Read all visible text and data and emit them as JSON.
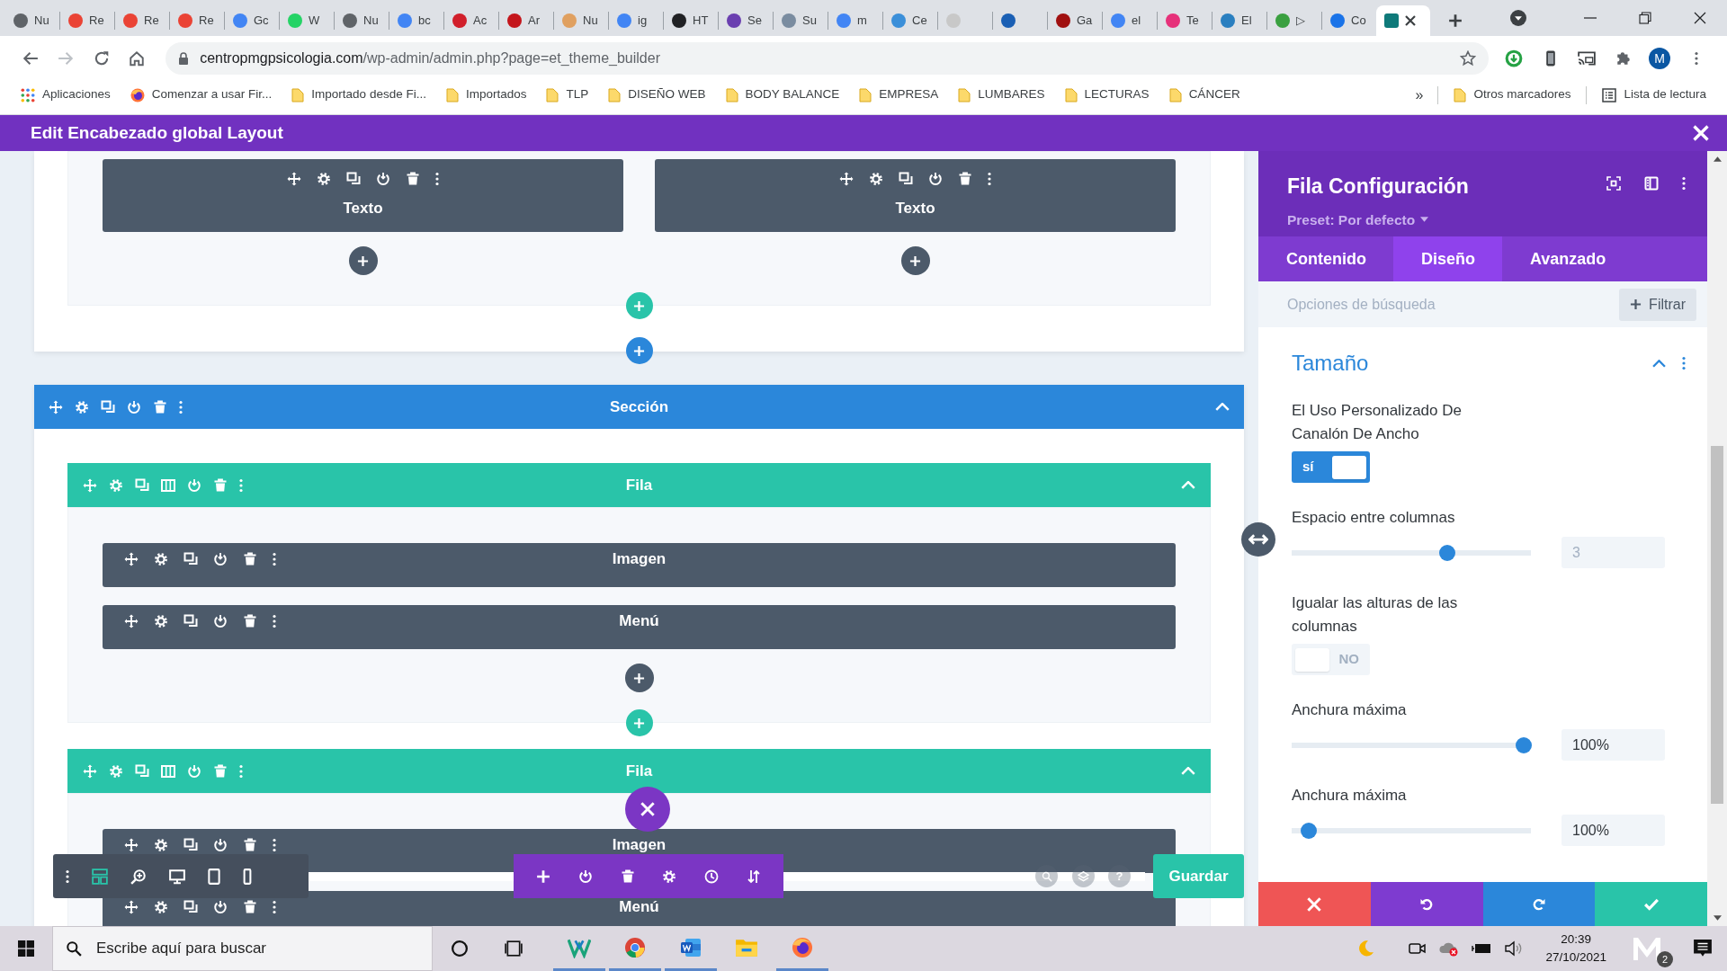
{
  "browser": {
    "tabs": [
      {
        "title": "Nu",
        "color": "#5f6368",
        "selected": false
      },
      {
        "title": "Re",
        "color": "#ea4335",
        "selected": false
      },
      {
        "title": "Re",
        "color": "#ea4335",
        "selected": false
      },
      {
        "title": "Re",
        "color": "#ea4335",
        "selected": false
      },
      {
        "title": "Gc",
        "color": "#4285f4",
        "selected": false
      },
      {
        "title": "W",
        "color": "#25d366",
        "selected": false
      },
      {
        "title": "Nu",
        "color": "#5f6368",
        "selected": false
      },
      {
        "title": "bc",
        "color": "#4285f4",
        "selected": false
      },
      {
        "title": "Ac",
        "color": "#d11f2b",
        "selected": false
      },
      {
        "title": "Ar",
        "color": "#c4161c",
        "selected": false
      },
      {
        "title": "Nu",
        "color": "#e0a060",
        "selected": false
      },
      {
        "title": "ig",
        "color": "#4285f4",
        "selected": false
      },
      {
        "title": "HT",
        "color": "#202124",
        "selected": false
      },
      {
        "title": "Se",
        "color": "#6a3fb0",
        "selected": false
      },
      {
        "title": "Su",
        "color": "#7a8ca0",
        "selected": false
      },
      {
        "title": "m",
        "color": "#4285f4",
        "selected": false
      },
      {
        "title": "Ce",
        "color": "#3b8fd9",
        "selected": false
      },
      {
        "color": "#c8c8c8",
        "selected": false
      },
      {
        "color": "#1a5fb4",
        "selected": false
      },
      {
        "title": "Ga",
        "color": "#a01010",
        "selected": false
      },
      {
        "title": "el",
        "color": "#4285f4",
        "selected": false
      },
      {
        "title": "Te",
        "color": "#e6317a",
        "selected": false
      },
      {
        "title": "El",
        "color": "#2a7fc0",
        "selected": false
      },
      {
        "title": "▷",
        "color": "#3aa040",
        "selected": false
      },
      {
        "title": "Co",
        "color": "#1a73e8",
        "selected": false
      },
      {
        "color": "#0f7a7a",
        "selected": true
      }
    ],
    "address": {
      "host": "centropmgpsicologia.com",
      "path": "/wp-admin/admin.php?page=et_theme_builder"
    },
    "profile_initial": "M",
    "bookmarks": [
      {
        "kind": "apps",
        "label": "Aplicaciones"
      },
      {
        "kind": "page",
        "label": "Comenzar a usar Fir..."
      },
      {
        "kind": "folder",
        "label": "Importado desde Fi..."
      },
      {
        "kind": "folder",
        "label": "Importados"
      },
      {
        "kind": "folder",
        "label": "TLP"
      },
      {
        "kind": "folder",
        "label": "DISEÑO WEB"
      },
      {
        "kind": "folder",
        "label": "BODY BALANCE"
      },
      {
        "kind": "folder",
        "label": "EMPRESA"
      },
      {
        "kind": "folder",
        "label": "LUMBARES"
      },
      {
        "kind": "folder",
        "label": "LECTURAS"
      },
      {
        "kind": "folder",
        "label": "CÁNCER"
      }
    ],
    "bookmarks_more": "»",
    "bookmarks_right": [
      {
        "kind": "folder",
        "label": "Otros marcadores"
      },
      {
        "kind": "list",
        "label": "Lista de lectura"
      }
    ]
  },
  "builder": {
    "title": "Edit Encabezado global Layout",
    "sections": [
      {
        "add_button": true,
        "rows": [
          {
            "add_button": true,
            "columns": [
              {
                "add_button": true,
                "modules": [
                  {
                    "label": "Texto"
                  }
                ]
              },
              {
                "add_button": true,
                "modules": [
                  {
                    "label": "Texto"
                  }
                ]
              }
            ]
          }
        ]
      },
      {
        "label": "Sección",
        "expanded": true,
        "rows": [
          {
            "label": "Fila",
            "expanded": true,
            "add_button": true,
            "columns": [
              {
                "add_button": true,
                "modules": [
                  {
                    "label": "Imagen"
                  },
                  {
                    "label": "Menú"
                  }
                ]
              }
            ]
          },
          {
            "label": "Fila",
            "expanded": true,
            "columns": [
              {
                "modules": [
                  {
                    "label": "Imagen"
                  },
                  {
                    "label": "Menú"
                  }
                ]
              }
            ]
          }
        ]
      }
    ],
    "toolbar": {
      "help": "?",
      "save": "Guardar"
    }
  },
  "panel": {
    "title": "Fila Configuración",
    "preset": "Preset: Por defecto",
    "tabs": [
      {
        "label": "Contenido",
        "selected": false
      },
      {
        "label": "Diseño",
        "selected": true
      },
      {
        "label": "Avanzado",
        "selected": false
      }
    ],
    "search": {
      "placeholder": "Opciones de búsqueda"
    },
    "filter": "Filtrar",
    "group": {
      "title": "Tamaño",
      "expanded": true
    },
    "settings": [
      {
        "kind": "toggle",
        "label": "El Uso Personalizado De Canalón De Ancho",
        "on": true,
        "state_label": "sí"
      },
      {
        "kind": "slider",
        "label": "Espacio entre columnas",
        "level": 0.65,
        "placeholder": "3"
      },
      {
        "kind": "toggle",
        "label": "Igualar las alturas de las columnas",
        "on": false,
        "state_label": "NO"
      },
      {
        "kind": "slider",
        "label": "Anchura máxima",
        "level": 0.97,
        "value": "100%"
      },
      {
        "kind": "slider",
        "label": "Anchura máxima",
        "level": 0.07,
        "value": "100%"
      }
    ]
  },
  "taskbar": {
    "search": {
      "placeholder": "Escribe aquí para buscar"
    },
    "apps": [
      {
        "kind": "security",
        "running": true
      },
      {
        "kind": "chrome",
        "running": true
      },
      {
        "kind": "word",
        "running": true
      },
      {
        "kind": "explorer",
        "running": false
      },
      {
        "kind": "firefox",
        "running": true
      }
    ],
    "time": "20:39",
    "date": "27/10/2021",
    "badge": "2"
  }
}
